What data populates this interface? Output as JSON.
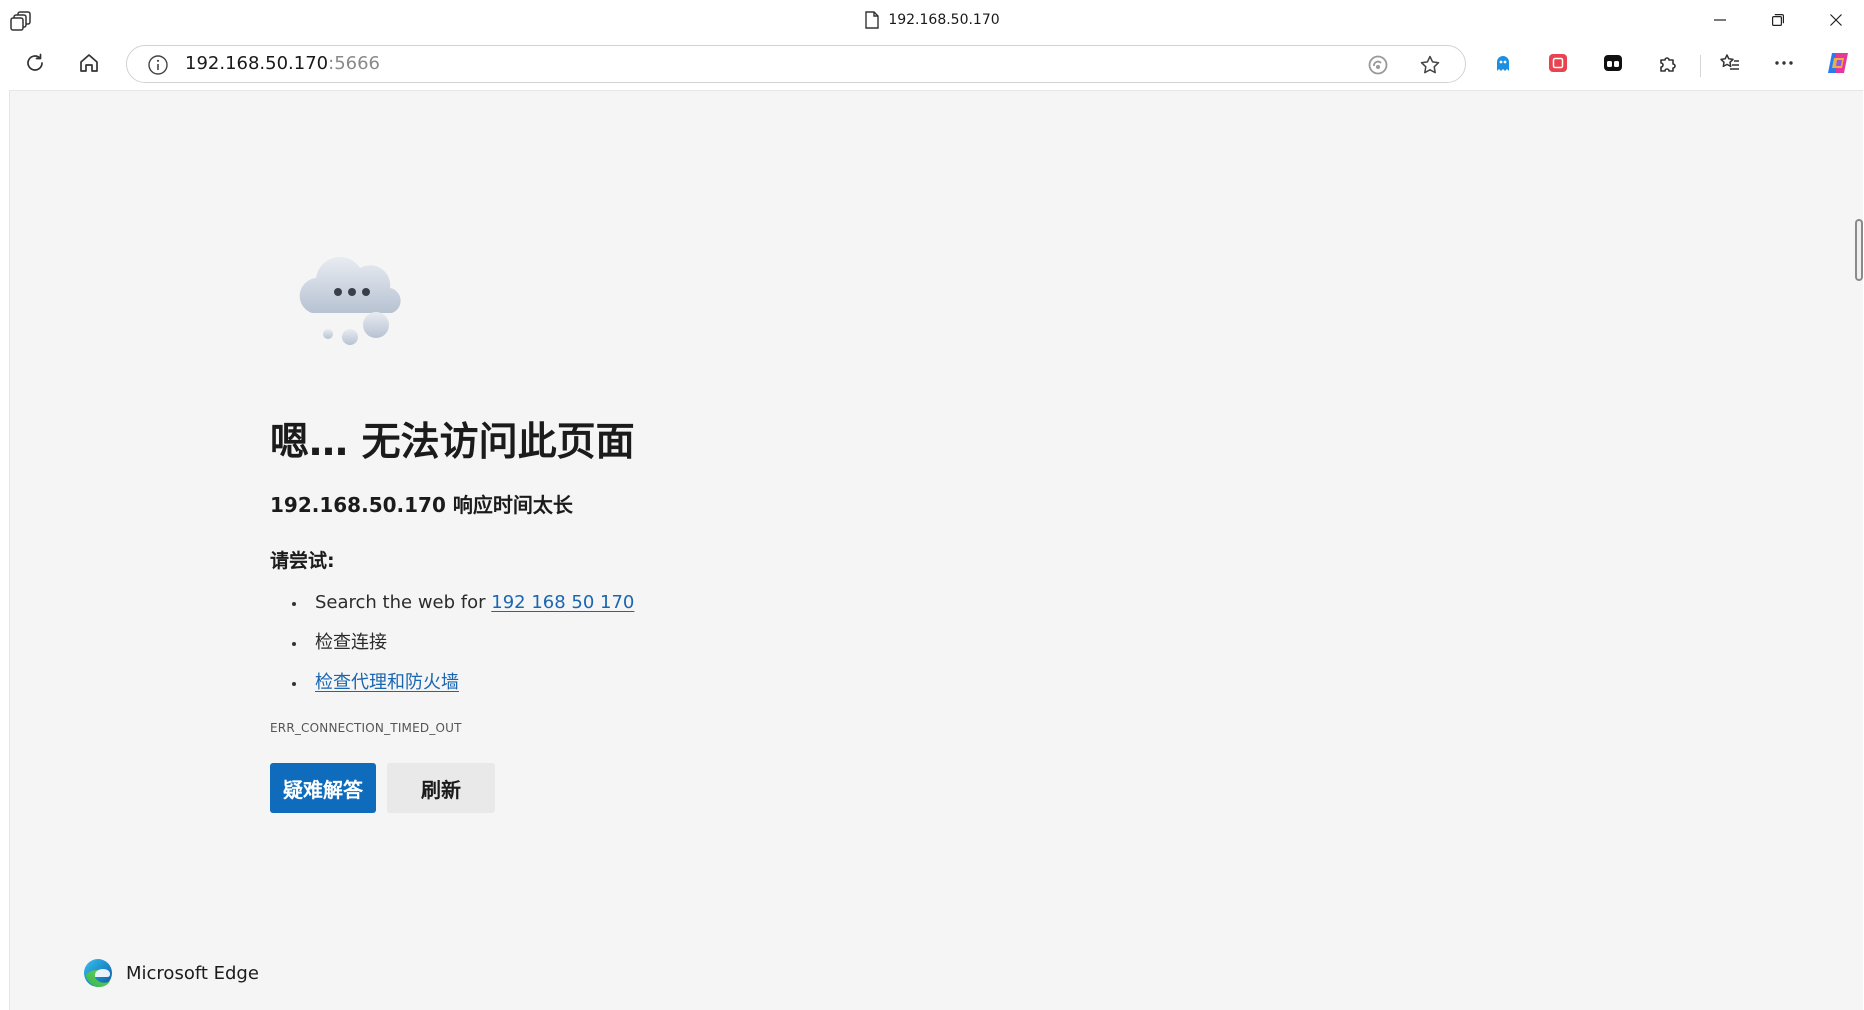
{
  "window": {
    "title": "192.168.50.170"
  },
  "address_bar": {
    "host": "192.168.50.170",
    "port": ":5666"
  },
  "error_page": {
    "title": "嗯… 无法访问此页面",
    "subtitle": "192.168.50.170 响应时间太长",
    "try_label": "请尝试:",
    "suggestions": {
      "search_prefix": "Search the web for ",
      "search_link": "192 168 50 170",
      "check_connection": "检查连接",
      "check_proxy": "检查代理和防火墙"
    },
    "error_code": "ERR_CONNECTION_TIMED_OUT",
    "troubleshoot_button": "疑难解答",
    "refresh_button": "刷新"
  },
  "brand": {
    "name": "Microsoft Edge"
  },
  "colors": {
    "accent": "#0f6cbd",
    "link": "#1a66b0",
    "page_background": "#f5f5f5"
  },
  "icons": [
    "workspaces-icon",
    "document-icon",
    "minimize-icon",
    "restore-icon",
    "close-icon",
    "refresh-icon",
    "home-icon",
    "info-icon",
    "read-aloud-icon",
    "favorite-star-icon",
    "ghost-extension-icon",
    "red-extension-icon",
    "black-extension-icon",
    "extensions-puzzle-icon",
    "favorites-icon",
    "more-icon",
    "copilot-icon",
    "cloud-icon",
    "edge-logo-icon"
  ]
}
